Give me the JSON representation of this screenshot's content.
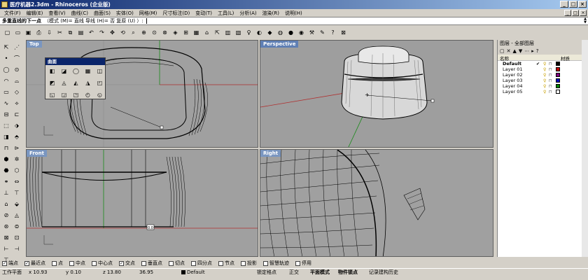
{
  "window": {
    "title": "医疗机器2.3dm - Rhinoceros (企业版)",
    "buttons": [
      "_",
      "□",
      "×"
    ]
  },
  "menu": {
    "items": [
      "文件(F)",
      "编辑(E)",
      "查看(V)",
      "曲线(C)",
      "曲面(S)",
      "实体(O)",
      "网格(M)",
      "尺寸标注(D)",
      "变动(T)",
      "工具(L)",
      "分析(A)",
      "渲染(R)",
      "说明(H)"
    ],
    "mdi_buttons": [
      "_",
      "□",
      "×"
    ]
  },
  "command": {
    "prompt": "多重直线的下一点",
    "options": "（模式 (M)= 直线  导线 (H)= 否  复原 (U) ）:"
  },
  "toolbar": {
    "icons": [
      "new-icon",
      "open-icon",
      "save-icon",
      "print-icon",
      "import-icon",
      "cut-icon",
      "copy-icon",
      "paste-icon",
      "undo-icon",
      "redo-icon",
      "pan-icon",
      "rotate-view-icon",
      "zoom-icon",
      "zoom-window-icon",
      "zoom-extents-icon",
      "zoom-selected-icon",
      "cplane-icon",
      "grid-icon",
      "four-view-icon",
      "named-view-icon",
      "select-icon",
      "layer-icon",
      "object-properties-icon",
      "light-icon",
      "render-icon",
      "material-icon",
      "color-icon",
      "environment-icon",
      "sphere-render-icon",
      "tools-icon",
      "options-icon",
      "help-icon",
      "dims-icon"
    ],
    "glyphs": [
      "▢",
      "▭",
      "▣",
      "⎙",
      "⇩",
      "✂",
      "⧉",
      "▤",
      "↶",
      "↷",
      "✥",
      "⟲",
      "⌕",
      "⊕",
      "⊙",
      "⊗",
      "◈",
      "⊞",
      "▦",
      "⌂",
      "⇱",
      "▥",
      "▧",
      "♀",
      "◐",
      "◆",
      "◍",
      "●",
      "◉",
      "⚒",
      "✎",
      "?",
      "⊠"
    ]
  },
  "left_toolbar": {
    "glyphs": [
      "⇱",
      "⋰",
      "•",
      "⌒",
      "◯",
      "⊙",
      "◠",
      "⌓",
      "▭",
      "◇",
      "∿",
      "⟡",
      "⊟",
      "⊏",
      "⬚",
      "⬗",
      "◨",
      "⬘",
      "⊓",
      "⊳",
      "⬢",
      "✲",
      "⬣",
      "⬡",
      "⚭",
      "⇔",
      "⊥",
      "⊤",
      "⌂",
      "⬙",
      "⊘",
      "◬",
      "⊛",
      "⊜",
      "⊠",
      "⊡",
      "⊢",
      "⊣",
      "⊤"
    ]
  },
  "viewports": {
    "top": "Top",
    "perspective": "Perspective",
    "front": "Front",
    "right": "Right"
  },
  "palette": {
    "title": "曲面",
    "glyphs": [
      "◧",
      "◪",
      "◯",
      "▦",
      "◫",
      "◩",
      "◬",
      "◭",
      "◮",
      "◰",
      "◱",
      "◲",
      "◳",
      "◴",
      "◵"
    ]
  },
  "layers": {
    "title": "图层 - 全部图层",
    "tools": [
      "▢",
      "✕",
      "▲",
      "▼",
      "⋯",
      "▸",
      "?"
    ],
    "columns": [
      "名称",
      "材质"
    ],
    "rows": [
      {
        "name": "Default",
        "color": "#000000",
        "current": true
      },
      {
        "name": "Layer 01",
        "color": "#c00000"
      },
      {
        "name": "Layer 02",
        "color": "#800080"
      },
      {
        "name": "Layer 03",
        "color": "#0000c0"
      },
      {
        "name": "Layer 04",
        "color": "#008000"
      },
      {
        "name": "Layer 05",
        "color": "#ffffff"
      }
    ],
    "current_mark": "✔",
    "bulb": "💡",
    "lock": "🔓"
  },
  "osnap": [
    {
      "label": "端点",
      "checked": true
    },
    {
      "label": "最近点",
      "checked": true
    },
    {
      "label": "点",
      "checked": false
    },
    {
      "label": "中点",
      "checked": false
    },
    {
      "label": "中心点",
      "checked": false
    },
    {
      "label": "交点",
      "checked": true
    },
    {
      "label": "垂直点",
      "checked": false
    },
    {
      "label": "切点",
      "checked": false
    },
    {
      "label": "四分点",
      "checked": false
    },
    {
      "label": "节点",
      "checked": false
    },
    {
      "label": "投影",
      "checked": false
    },
    {
      "label": "智慧轨迹",
      "checked": false
    },
    {
      "label": "停用",
      "checked": false
    }
  ],
  "status": {
    "cplane": "工作平面",
    "x": "x 10.93",
    "y": "y 0.10",
    "z": "z 13.80",
    "d": "36.95",
    "layer": "Default",
    "grid_snap": "锁定格点",
    "ortho": "正交",
    "planar": "平面模式",
    "osnap": "物件锁点",
    "history": "记录建构历史"
  },
  "dimension_tag": "0.0"
}
